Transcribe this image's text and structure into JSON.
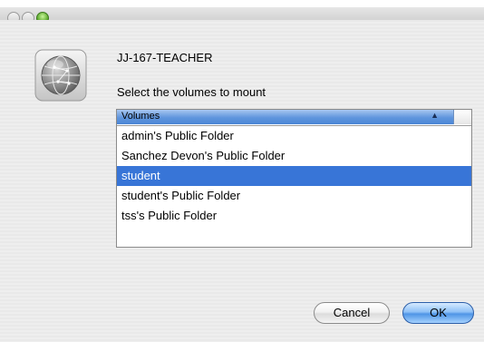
{
  "window": {
    "server_name": "JJ-167-TEACHER",
    "prompt": "Select the volumes to mount"
  },
  "volumes_list": {
    "column_header": "Volumes",
    "sort_direction": "ascending",
    "items": [
      {
        "label": "admin's Public Folder",
        "selected": false
      },
      {
        "label": "Sanchez Devon's Public Folder",
        "selected": false
      },
      {
        "label": "student",
        "selected": true
      },
      {
        "label": "student's Public Folder",
        "selected": false
      },
      {
        "label": "tss's Public Folder",
        "selected": false
      }
    ]
  },
  "buttons": {
    "cancel_label": "Cancel",
    "ok_label": "OK"
  },
  "icons": {
    "server": "network-globe-icon",
    "window_close": "close-icon",
    "window_minimize": "minimize-icon",
    "window_zoom": "zoom-icon"
  },
  "colors": {
    "selection": "#3875d7",
    "header_blue": "#5f95dd",
    "default_button": "#4f95e6"
  }
}
